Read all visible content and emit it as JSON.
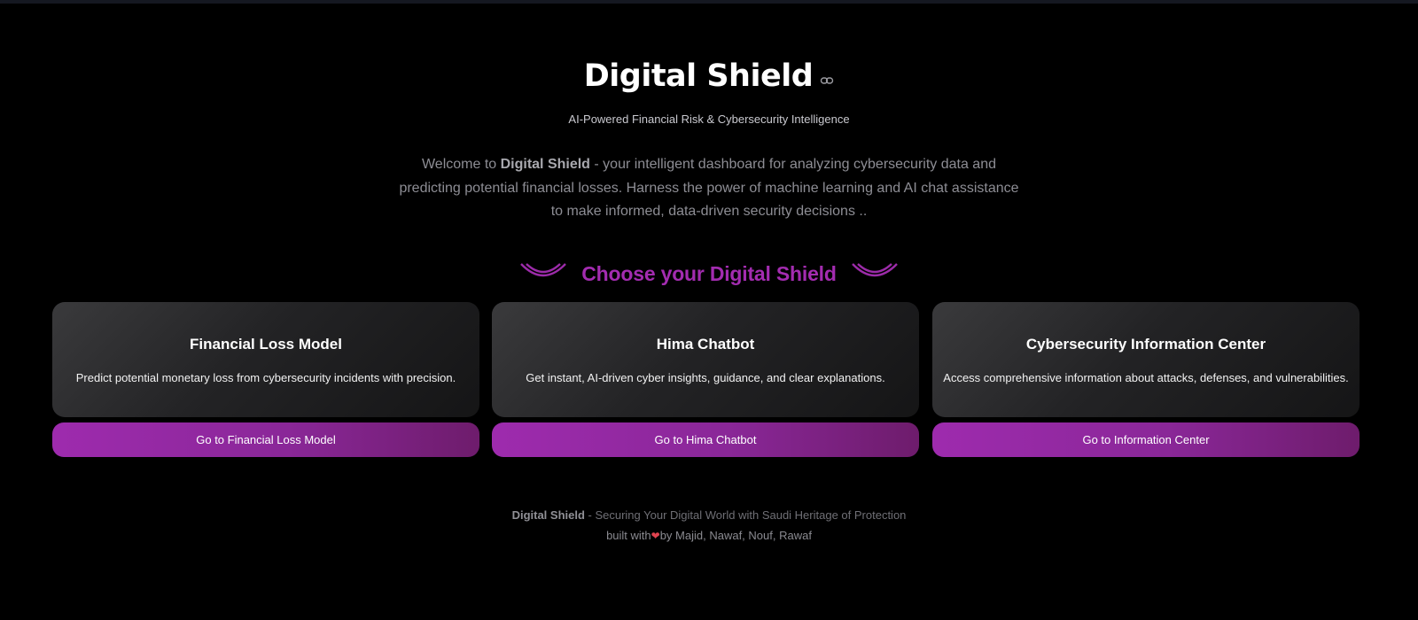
{
  "header": {
    "title": "Digital Shield",
    "subtitle": "AI-Powered Financial Risk & Cybersecurity Intelligence"
  },
  "intro": {
    "prefix": "Welcome to ",
    "brand": "Digital Shield",
    "text": " - your intelligent dashboard for analyzing cybersecurity data and predicting potential financial losses. Harness the power of machine learning and AI chat assistance to make informed, data-driven security decisions .."
  },
  "choose": {
    "heading": "Choose your Digital Shield"
  },
  "cards": [
    {
      "title": "Financial Loss Model",
      "description": "Predict potential monetary loss from cybersecurity incidents with precision.",
      "button_label": "Go to Financial Loss Model"
    },
    {
      "title": "Hima Chatbot",
      "description": "Get instant, AI-driven cyber insights, guidance, and clear explanations.",
      "button_label": "Go to Hima Chatbot"
    },
    {
      "title": "Cybersecurity Information Center",
      "description": "Access comprehensive information about attacks, defenses, and vulnerabilities.",
      "button_label": "Go to Information Center"
    }
  ],
  "footer": {
    "brand": "Digital Shield",
    "tagline": " - Securing Your Digital World with Saudi Heritage of Protection",
    "built_prefix": "built with",
    "heart": "❤",
    "built_suffix": "by Majid, Nawaf, Nouf, Rawaf"
  },
  "icons": {
    "title_link": "link-icon",
    "decor_left": "arc-icon",
    "decor_right": "arc-icon",
    "footer_heart": "heart-icon"
  },
  "colors": {
    "accent": "#a32cb0",
    "background": "#000000",
    "button_start": "#9e2bae",
    "button_end": "#6e1c6c",
    "heart": "#e0434f"
  }
}
